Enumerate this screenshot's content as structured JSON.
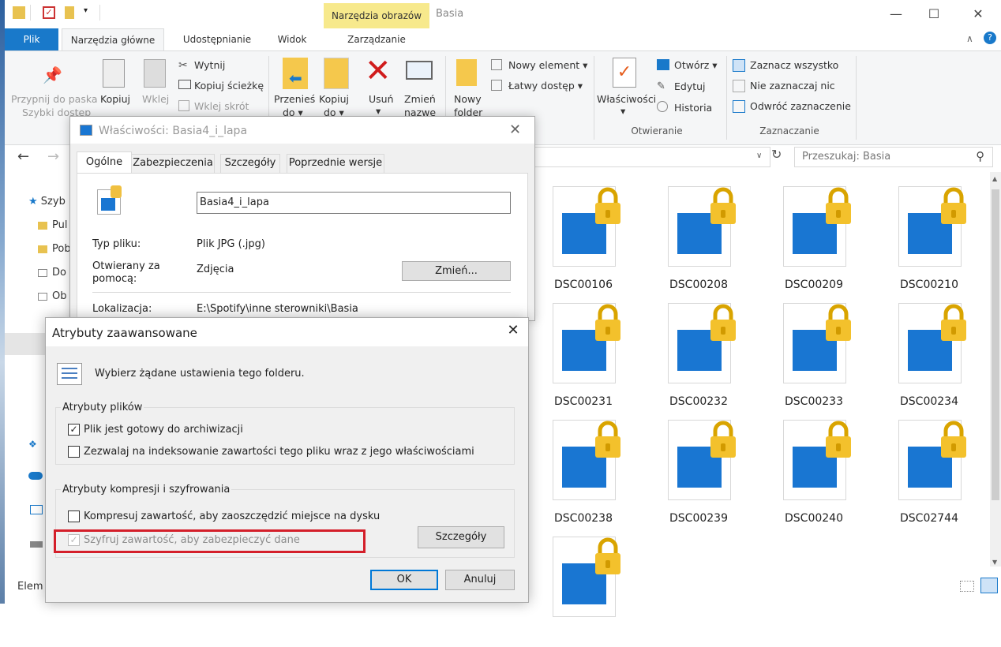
{
  "window": {
    "title": "Basia",
    "context_tab": "Narzędzia obrazów"
  },
  "tabs": {
    "plik": "Plik",
    "main": "Narzędzia główne",
    "share": "Udostępnianie",
    "view": "Widok",
    "manage": "Zarządzanie"
  },
  "ribbon": {
    "pin": [
      "Przypnij do paska",
      "Szybki dostęp"
    ],
    "copy": "Kopiuj",
    "paste": "Wklej",
    "cut": "Wytnij",
    "copy_path": "Kopiuj ścieżkę",
    "paste_shortcut": "Wklej skrót",
    "move": [
      "Przenieś",
      "do ▾"
    ],
    "copy_to": [
      "Kopiuj",
      "do ▾"
    ],
    "delete": [
      "Usuń",
      "▾"
    ],
    "rename": [
      "Zmień",
      "nazwę"
    ],
    "new_folder": [
      "Nowy",
      "folder"
    ],
    "new_item": "Nowy element ▾",
    "easy_access": "Łatwy dostęp ▾",
    "properties": [
      "Właściwości",
      "▾"
    ],
    "open": "Otwórz ▾",
    "edit": "Edytuj",
    "history": "Historia",
    "open_group": "Otwieranie",
    "select_all": "Zaznacz wszystko",
    "select_none": "Nie zaznaczaj nic",
    "invert": "Odwróć zaznaczenie",
    "select_group": "Zaznaczanie"
  },
  "search": {
    "placeholder": "Przeszukaj: Basia"
  },
  "nav": [
    "Szyb",
    "Pul",
    "Pob",
    "Do",
    "Ob",
    "Elem"
  ],
  "files": [
    "DSC00106",
    "DSC00208",
    "DSC00209",
    "DSC00210",
    "DSC00231",
    "DSC00232",
    "DSC00233",
    "DSC00234",
    "DSC00238",
    "DSC00239",
    "DSC00240",
    "DSC02744"
  ],
  "props": {
    "title": "Właściwości: Basia4_i_lapa",
    "tabs": [
      "Ogólne",
      "Zabezpieczenia",
      "Szczegóły",
      "Poprzednie wersje"
    ],
    "filename": "Basia4_i_lapa",
    "type_label": "Typ pliku:",
    "type_value": "Plik JPG (.jpg)",
    "opens_label": [
      "Otwierany za",
      "pomocą:"
    ],
    "opens_value": "Zdjęcia",
    "change_button": "Zmień...",
    "location_label": "Lokalizacja:",
    "location_value": "E:\\Spotify\\inne sterowniki\\Basia"
  },
  "adv": {
    "title": "Atrybuty zaawansowane",
    "intro": "Wybierz żądane ustawienia tego folderu.",
    "file_attrs": "Atrybuty plików",
    "archive": "Plik jest gotowy do archiwizacji",
    "archive_checked": "✓",
    "index": "Zezwalaj na indeksowanie zawartości tego pliku wraz z jego właściwościami",
    "compress_group": "Atrybuty kompresji i szyfrowania",
    "compress": "Kompresuj zawartość, aby zaoszczędzić miejsce na dysku",
    "encrypt": "Szyfruj zawartość, aby zabezpieczyć dane",
    "encrypt_checked": "✓",
    "details_button": "Szczegóły",
    "ok": "OK",
    "cancel": "Anuluj"
  }
}
